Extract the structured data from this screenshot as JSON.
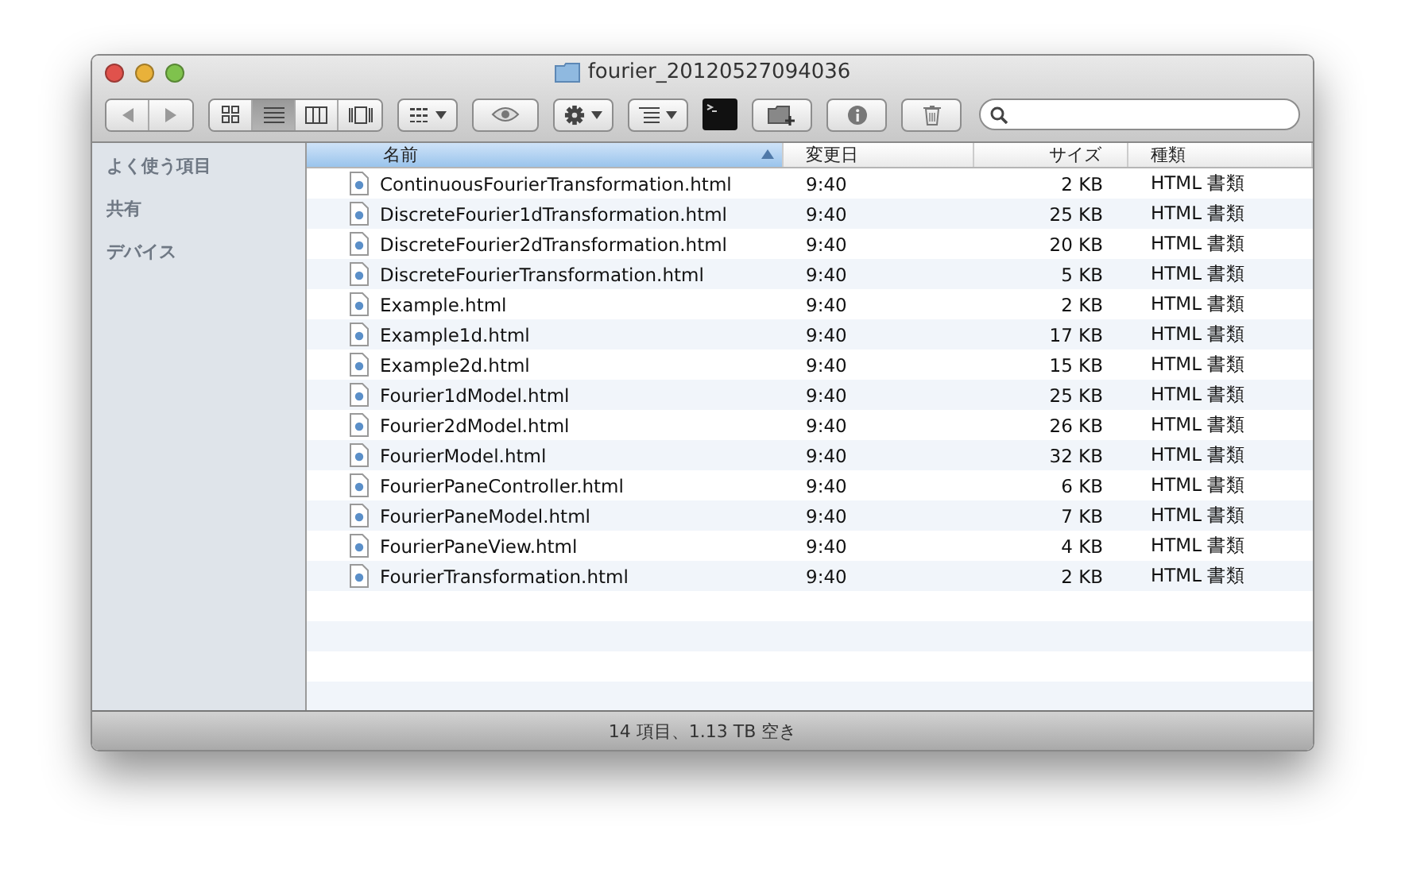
{
  "window": {
    "title": "fourier_20120527094036"
  },
  "toolbar": {
    "view_modes": [
      {
        "kind": "icons",
        "selected": false
      },
      {
        "kind": "list",
        "selected": true
      },
      {
        "kind": "columns",
        "selected": false
      },
      {
        "kind": "coverflow",
        "selected": false
      }
    ]
  },
  "sidebar": {
    "sections": [
      "よく使う項目",
      "共有",
      "デバイス"
    ]
  },
  "table": {
    "columns": [
      {
        "label": "名前",
        "selected": true
      },
      {
        "label": "変更日",
        "selected": false
      },
      {
        "label": "サイズ",
        "selected": false
      },
      {
        "label": "種類",
        "selected": false
      }
    ],
    "rows": [
      {
        "name": "ContinuousFourierTransformation.html",
        "date": "9:40",
        "size": "2 KB",
        "type": "HTML 書類"
      },
      {
        "name": "DiscreteFourier1dTransformation.html",
        "date": "9:40",
        "size": "25 KB",
        "type": "HTML 書類"
      },
      {
        "name": "DiscreteFourier2dTransformation.html",
        "date": "9:40",
        "size": "20 KB",
        "type": "HTML 書類"
      },
      {
        "name": "DiscreteFourierTransformation.html",
        "date": "9:40",
        "size": "5 KB",
        "type": "HTML 書類"
      },
      {
        "name": "Example.html",
        "date": "9:40",
        "size": "2 KB",
        "type": "HTML 書類"
      },
      {
        "name": "Example1d.html",
        "date": "9:40",
        "size": "17 KB",
        "type": "HTML 書類"
      },
      {
        "name": "Example2d.html",
        "date": "9:40",
        "size": "15 KB",
        "type": "HTML 書類"
      },
      {
        "name": "Fourier1dModel.html",
        "date": "9:40",
        "size": "25 KB",
        "type": "HTML 書類"
      },
      {
        "name": "Fourier2dModel.html",
        "date": "9:40",
        "size": "26 KB",
        "type": "HTML 書類"
      },
      {
        "name": "FourierModel.html",
        "date": "9:40",
        "size": "32 KB",
        "type": "HTML 書類"
      },
      {
        "name": "FourierPaneController.html",
        "date": "9:40",
        "size": "6 KB",
        "type": "HTML 書類"
      },
      {
        "name": "FourierPaneModel.html",
        "date": "9:40",
        "size": "7 KB",
        "type": "HTML 書類"
      },
      {
        "name": "FourierPaneView.html",
        "date": "9:40",
        "size": "4 KB",
        "type": "HTML 書類"
      },
      {
        "name": "FourierTransformation.html",
        "date": "9:40",
        "size": "2 KB",
        "type": "HTML 書類"
      }
    ]
  },
  "status_bar": {
    "text": "14 項目、1.13 TB 空き"
  }
}
